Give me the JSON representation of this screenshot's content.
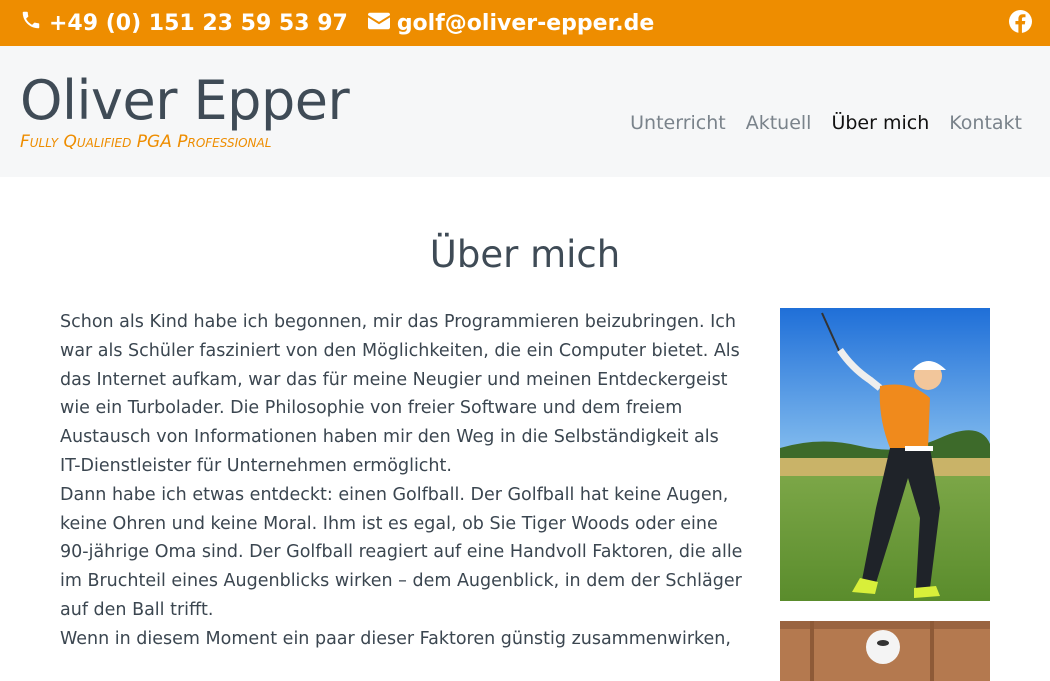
{
  "topbar": {
    "phone": "+49 (0) 151 23 59 53 97",
    "email": "golf@oliver-epper.de",
    "icons": [
      "phone-icon",
      "envelope-icon",
      "facebook-icon"
    ],
    "bg_color": "#ee8d00"
  },
  "brand": {
    "name": "Oliver Epper",
    "tagline": "Fully Qualified PGA Professional"
  },
  "nav": {
    "items": [
      {
        "label": "Unterricht",
        "active": false
      },
      {
        "label": "Aktuell",
        "active": false
      },
      {
        "label": "Über mich",
        "active": true
      },
      {
        "label": "Kontakt",
        "active": false
      }
    ]
  },
  "main": {
    "title": "Über mich",
    "paragraphs": [
      "Schon als Kind habe ich begonnen, mir das Programmieren beizubringen. Ich war als Schüler fasziniert von den Möglichkeiten, die ein Computer bietet. Als das Internet aufkam, war das für meine Neugier und meinen Entdeckergeist wie ein Turbolader. Die Philosophie von freier Software und dem freiem Austausch von Informationen haben mir den Weg in die Selbständigkeit als IT-Dienstleister für Unternehmen ermöglicht.",
      "Dann habe ich etwas entdeckt: einen Golfball. Der Golfball hat keine Augen, keine Ohren und keine Moral. Ihm ist es egal, ob Sie Tiger Woods oder eine 90-jährige Oma sind. Der Golfball reagiert auf eine Handvoll Faktoren, die alle im Bruchteil eines Augenblicks wirken – dem Augenblick, in dem der Schläger auf den Ball trifft.",
      "Wenn in diesem Moment ein paar dieser Faktoren günstig zusammenwirken,"
    ]
  }
}
